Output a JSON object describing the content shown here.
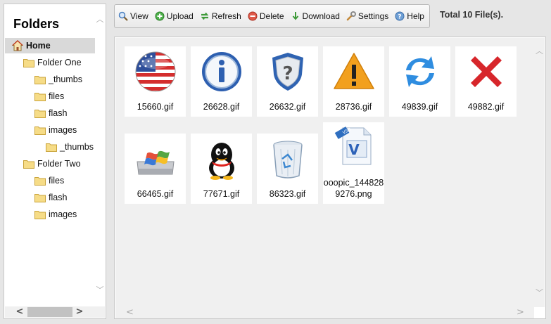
{
  "sidebar": {
    "title": "Folders",
    "items": [
      {
        "label": "Home",
        "level": 0,
        "type": "home",
        "selected": true
      },
      {
        "label": "Folder One",
        "level": 1,
        "type": "folder"
      },
      {
        "label": "_thumbs",
        "level": 2,
        "type": "folder"
      },
      {
        "label": "files",
        "level": 2,
        "type": "folder"
      },
      {
        "label": "flash",
        "level": 2,
        "type": "folder"
      },
      {
        "label": "images",
        "level": 2,
        "type": "folder"
      },
      {
        "label": "_thumbs",
        "level": 3,
        "type": "folder"
      },
      {
        "label": "Folder Two",
        "level": 1,
        "type": "folder"
      },
      {
        "label": "files",
        "level": 2,
        "type": "folder"
      },
      {
        "label": "flash",
        "level": 2,
        "type": "folder"
      },
      {
        "label": "images",
        "level": 2,
        "type": "folder"
      }
    ]
  },
  "toolbar": {
    "buttons": [
      {
        "label": "View",
        "icon": "magnifier-icon"
      },
      {
        "label": "Upload",
        "icon": "upload-plus-icon"
      },
      {
        "label": "Refresh",
        "icon": "refresh-arrows-icon"
      },
      {
        "label": "Delete",
        "icon": "delete-minus-icon"
      },
      {
        "label": "Download",
        "icon": "download-arrow-icon"
      },
      {
        "label": "Settings",
        "icon": "wrench-icon"
      },
      {
        "label": "Help",
        "icon": "help-icon"
      }
    ]
  },
  "status": {
    "total_files": "Total 10 File(s)."
  },
  "files": [
    {
      "name": "15660.gif",
      "icon": "us-flag-icon"
    },
    {
      "name": "26628.gif",
      "icon": "info-icon"
    },
    {
      "name": "26632.gif",
      "icon": "question-shield-icon"
    },
    {
      "name": "28736.gif",
      "icon": "warning-icon"
    },
    {
      "name": "49839.gif",
      "icon": "blue-refresh-icon"
    },
    {
      "name": "49882.gif",
      "icon": "red-x-icon"
    },
    {
      "name": "66465.gif",
      "icon": "windows-drive-icon"
    },
    {
      "name": "77671.gif",
      "icon": "penguin-icon"
    },
    {
      "name": "86323.gif",
      "icon": "recycle-bin-icon"
    },
    {
      "name": "ooopic_1448289276.png",
      "icon": "visio-document-icon"
    }
  ],
  "colors": {
    "accent_blue": "#2b74c8",
    "delete_red": "#d23a2a",
    "folder_yellow": "#f3d36a",
    "selection_bg": "#d9d9d9"
  }
}
